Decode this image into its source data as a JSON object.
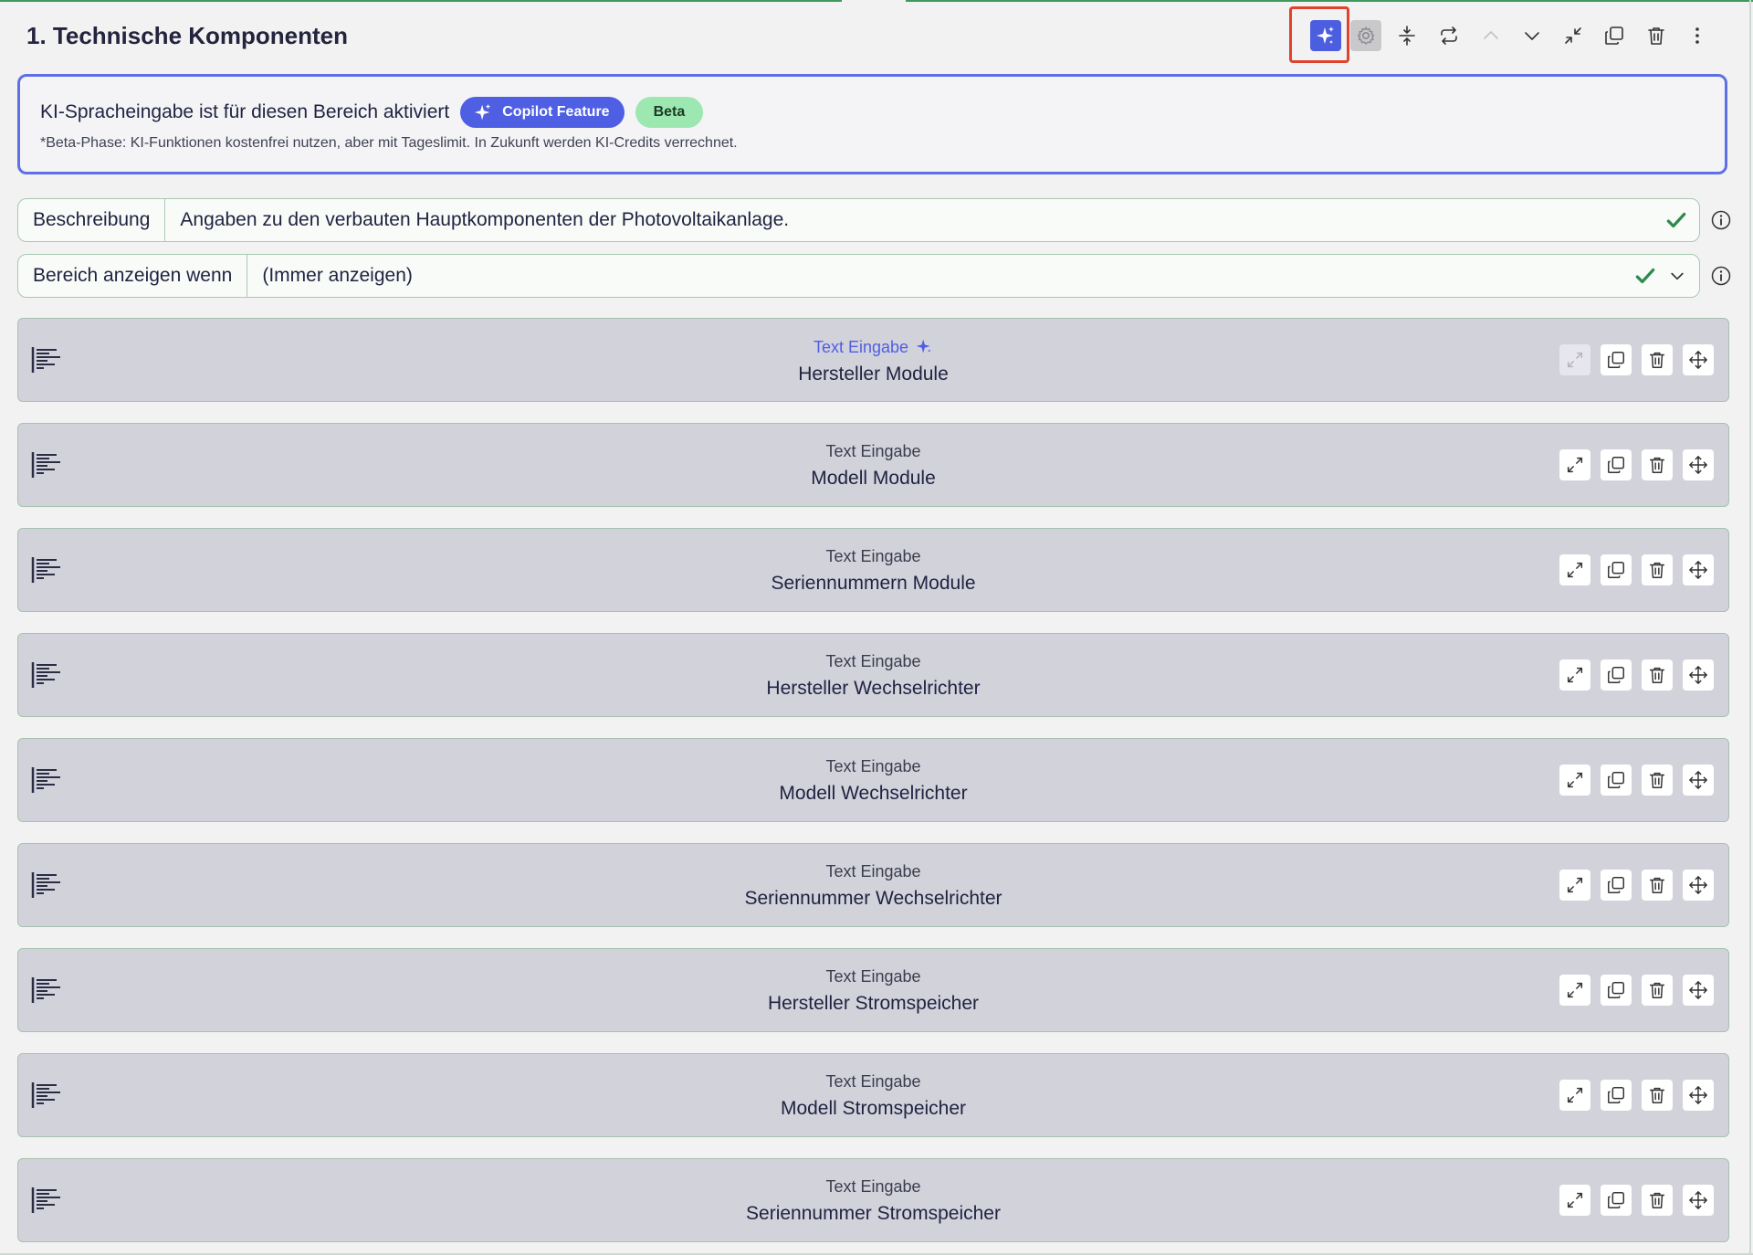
{
  "section": {
    "title": "1. Technische Komponenten",
    "toolbar": [
      {
        "name": "copilot-button",
        "icon": "sparkle-icon",
        "active": true
      },
      {
        "name": "settings-button",
        "icon": "gear-icon"
      },
      {
        "name": "collapse-all-button",
        "icon": "compress-vertical-icon"
      },
      {
        "name": "repeat-button",
        "icon": "repeat-icon"
      },
      {
        "name": "move-up-button",
        "icon": "chevron-up-icon"
      },
      {
        "name": "move-down-button",
        "icon": "chevron-down-icon"
      },
      {
        "name": "minimize-button",
        "icon": "minimize-icon"
      },
      {
        "name": "duplicate-button",
        "icon": "copy-icon"
      },
      {
        "name": "delete-button",
        "icon": "trash-icon"
      },
      {
        "name": "more-button",
        "icon": "more-vertical-icon"
      }
    ]
  },
  "ai_banner": {
    "text": "KI-Spracheingabe ist für diesen Bereich aktiviert",
    "copilot_label": "Copilot Feature",
    "beta_label": "Beta",
    "note": "*Beta-Phase: KI-Funktionen kostenfrei nutzen, aber mit Tageslimit. In Zukunft werden KI-Credits verrechnet."
  },
  "description_field": {
    "label": "Beschreibung",
    "value": "Angaben zu den verbauten Hauptkomponenten der Photovoltaikanlage."
  },
  "condition_field": {
    "label": "Bereich anzeigen wenn",
    "value": "(Immer anzeigen)"
  },
  "cards": [
    {
      "type": "Text Eingabe",
      "name": "Hersteller Module",
      "ai": true
    },
    {
      "type": "Text Eingabe",
      "name": "Modell Module",
      "ai": false
    },
    {
      "type": "Text Eingabe",
      "name": "Seriennummern Module",
      "ai": false
    },
    {
      "type": "Text Eingabe",
      "name": "Hersteller Wechselrichter",
      "ai": false
    },
    {
      "type": "Text Eingabe",
      "name": "Modell Wechselrichter",
      "ai": false
    },
    {
      "type": "Text Eingabe",
      "name": "Seriennummer Wechselrichter",
      "ai": false
    },
    {
      "type": "Text Eingabe",
      "name": "Hersteller Stromspeicher",
      "ai": false
    },
    {
      "type": "Text Eingabe",
      "name": "Modell Stromspeicher",
      "ai": false
    },
    {
      "type": "Text Eingabe",
      "name": "Seriennummer Stromspeicher",
      "ai": false
    }
  ],
  "colors": {
    "accent": "#4e5fe3",
    "success": "#2e8b4a",
    "highlight": "#e0422e",
    "card_bg": "#d2d2db"
  }
}
